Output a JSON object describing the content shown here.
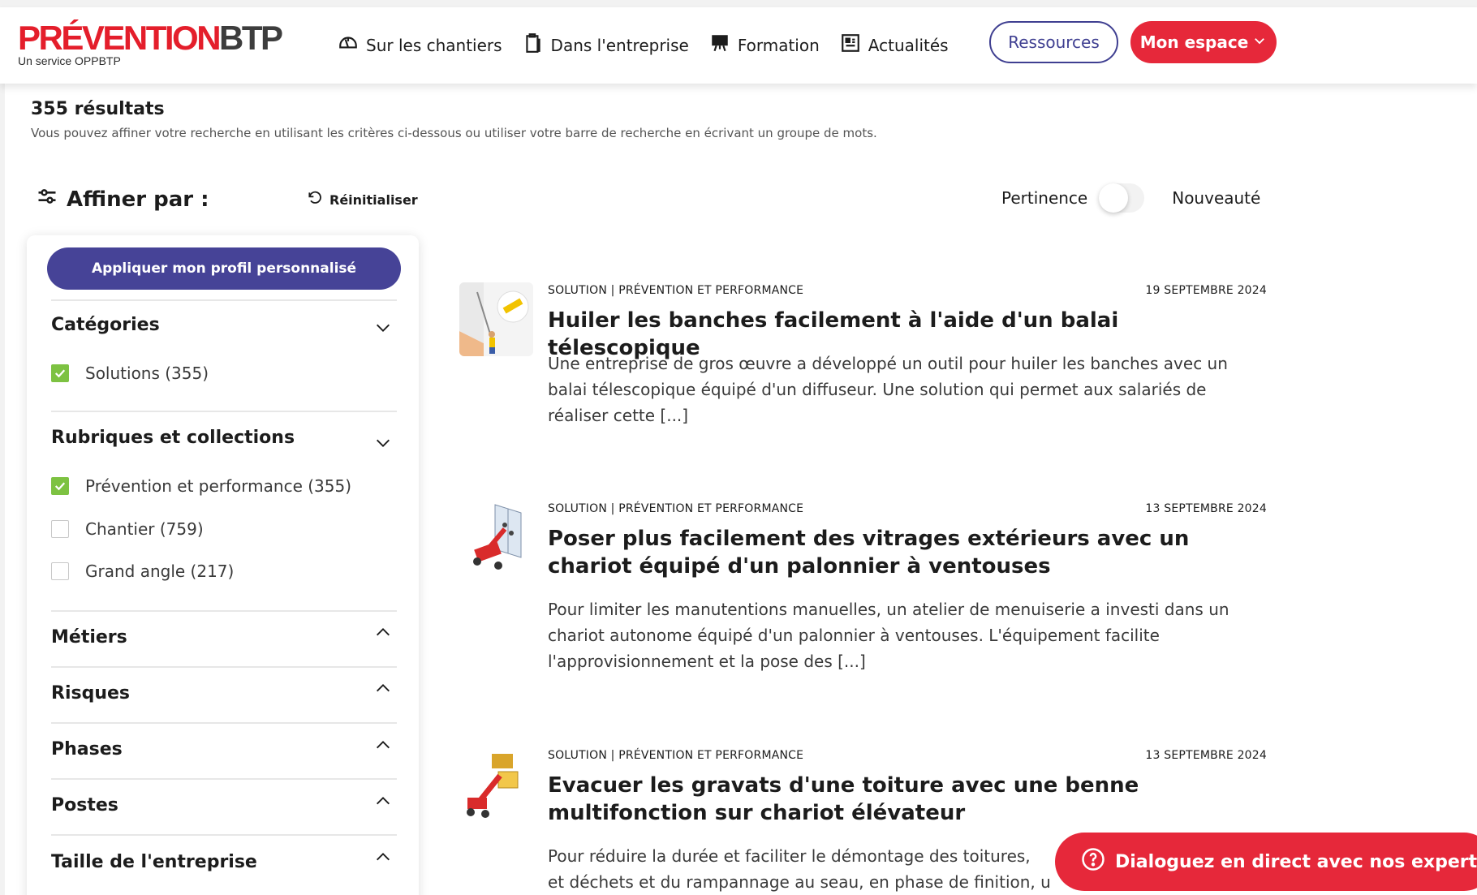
{
  "logo": {
    "brand_red": "PRÉVENTION",
    "brand_dark": "BTP",
    "subtitle": "Un service OPPBTP"
  },
  "nav": {
    "items": [
      {
        "label": "Sur les chantiers",
        "icon": "helmet-icon"
      },
      {
        "label": "Dans l'entreprise",
        "icon": "clipboard-icon"
      },
      {
        "label": "Formation",
        "icon": "presentation-board-icon"
      },
      {
        "label": "Actualités",
        "icon": "newspaper-icon"
      }
    ],
    "ressources_label": "Ressources",
    "mon_espace_label": "Mon espace"
  },
  "results": {
    "count_label": "355 résultats",
    "help_text": "Vous pouvez affiner votre recherche en utilisant les critères ci-dessous ou utiliser votre barre de recherche en écrivant un groupe de mots."
  },
  "filters": {
    "title": "Affiner par :",
    "reset_label": "Réinitialiser",
    "apply_profile_label": "Appliquer mon profil personnalisé",
    "sections": [
      {
        "title": "Catégories",
        "expanded": true,
        "options": [
          {
            "label": "Solutions (355)",
            "checked": true
          }
        ]
      },
      {
        "title": "Rubriques et collections",
        "expanded": true,
        "options": [
          {
            "label": "Prévention et performance (355)",
            "checked": true
          },
          {
            "label": "Chantier (759)",
            "checked": false
          },
          {
            "label": "Grand angle (217)",
            "checked": false
          }
        ]
      },
      {
        "title": "Métiers",
        "expanded": false
      },
      {
        "title": "Risques",
        "expanded": false
      },
      {
        "title": "Phases",
        "expanded": false
      },
      {
        "title": "Postes",
        "expanded": false
      },
      {
        "title": "Taille de l'entreprise",
        "expanded": false
      }
    ]
  },
  "sort": {
    "left_label": "Pertinence",
    "right_label": "Nouveauté",
    "selected": "Pertinence"
  },
  "articles": [
    {
      "category": "SOLUTION | PRÉVENTION ET PERFORMANCE",
      "date": "19 SEPTEMBRE 2024",
      "title": "Huiler les banches facilement à l'aide d'un balai télescopique",
      "description": "Une entreprise de gros œuvre a développé un outil pour huiler les banches avec un balai télescopique équipé d'un diffuseur. Une solution qui permet aux salariés de réaliser cette [...]"
    },
    {
      "category": "SOLUTION | PRÉVENTION ET PERFORMANCE",
      "date": "13 SEPTEMBRE 2024",
      "title": "Poser plus facilement des vitrages extérieurs avec un chariot équipé d'un palonnier à ventouses",
      "description": "Pour limiter les manutentions manuelles, un atelier de menuiserie a investi dans un chariot autonome équipé d'un palonnier à ventouses. L'équipement facilite l'approvisionnement et la pose des [...]"
    },
    {
      "category": "SOLUTION | PRÉVENTION ET PERFORMANCE",
      "date": "13 SEPTEMBRE 2024",
      "title": "Evacuer les gravats d'une toiture avec une benne multifonction sur chariot élévateur",
      "description": "Pour réduire la durée et faciliter le démontage des toitures,"
    }
  ],
  "article_desc3_line2": "et déchets et du rampannage au seau, en phase de finition, u",
  "chat": {
    "label": "Dialoguez en direct avec nos experts",
    "icon": "question-circle-icon"
  },
  "colors": {
    "brand_red": "#e41e2b",
    "brand_indigo": "#464397",
    "check_green": "#7dc242"
  }
}
